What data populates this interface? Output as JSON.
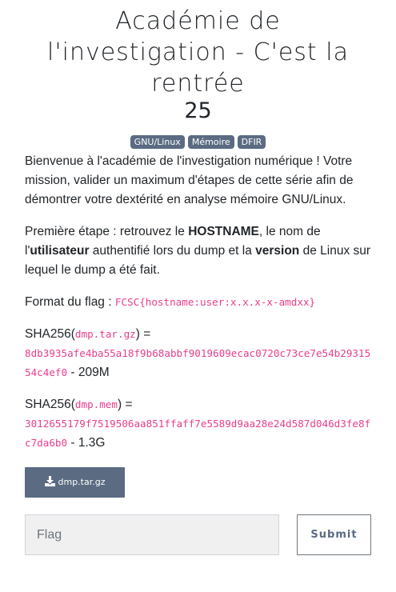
{
  "challenge": {
    "title": "Académie de l'investigation - C'est la rentrée",
    "points": "25",
    "tags": [
      "GNU/Linux",
      "Mémoire",
      "DFIR"
    ]
  },
  "description": {
    "intro": "Bienvenue à l'académie de l'investigation numérique ! Votre mission, valider un maximum d'étapes de cette série afin de démontrer votre dextérité en analyse mémoire GNU/Linux.",
    "step_prefix": "Première étape : retrouvez le ",
    "step_hostname": "HOSTNAME",
    "step_mid1": ", le nom de l'",
    "step_user": "utilisateur",
    "step_mid2": " authentifié lors du dump et la ",
    "step_version": "version",
    "step_suffix": " de Linux sur lequel le dump a été fait.",
    "format_label": "Format du flag : ",
    "format_value": "FCSC{hostname:user:x.x.x-x-amdxx}",
    "sha_label": "SHA256(",
    "sha_close": ") =",
    "file1_name": "dmp.tar.gz",
    "file1_hash": "8db3935afe4ba55a18f9b68abbf9019609ecac0720c73ce7e54b2931554c4ef0",
    "file1_size": " - 209M",
    "file2_name": "dmp.mem",
    "file2_hash": "3012655179f7519506aa851ffaff7e5589d9aa28e24d587d046d3fe8fc7da6b0",
    "file2_size": " - 1.3G"
  },
  "download": {
    "label": "dmp.tar.gz",
    "icon": "download-icon"
  },
  "form": {
    "flag_placeholder": "Flag",
    "flag_value": "",
    "submit_label": "Submit"
  },
  "colors": {
    "tag_bg": "#5a6b82",
    "code_text": "#e83e8c",
    "input_bg": "#f0f0f0"
  }
}
